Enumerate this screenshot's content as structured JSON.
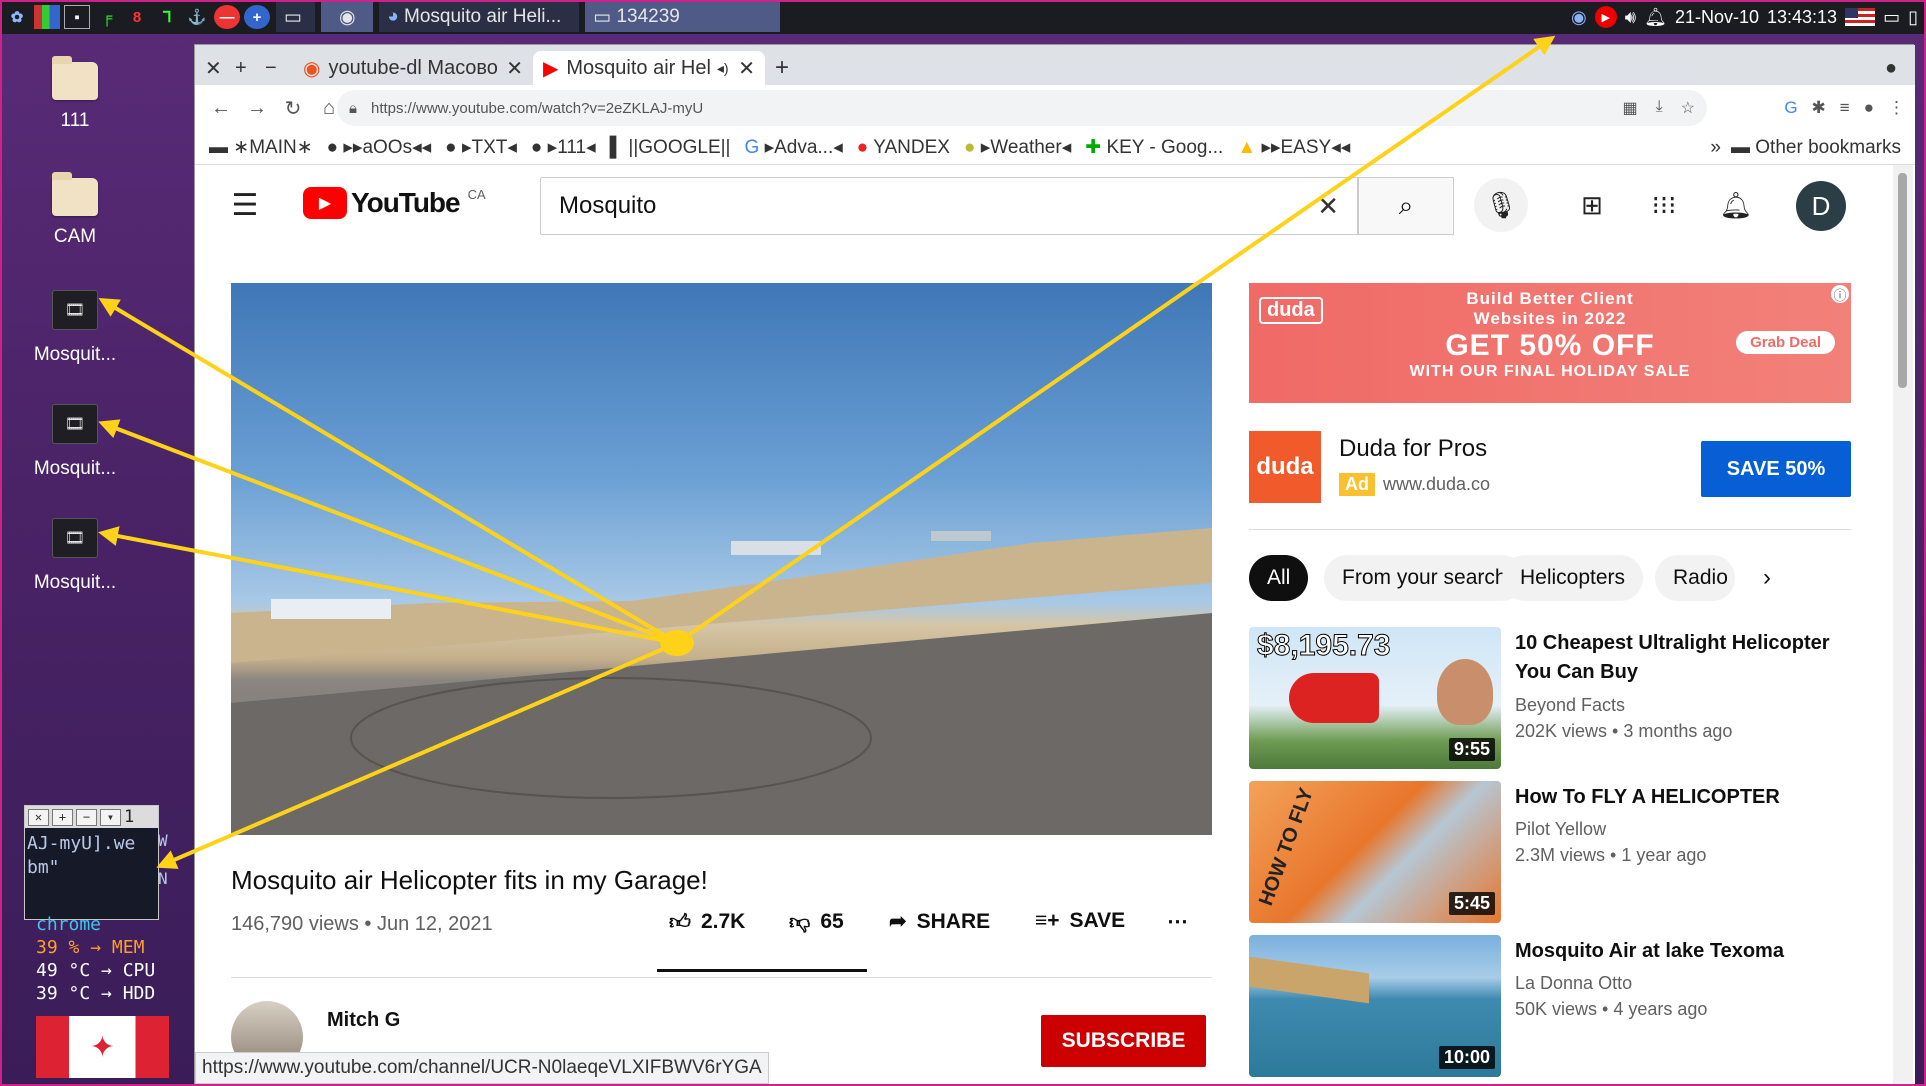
{
  "panel": {
    "tasks": [
      "",
      "Mosquito air Heli...",
      "134239"
    ],
    "date": "21-Nov-10",
    "time": "13:43:13"
  },
  "desktop": {
    "icons": [
      "111",
      "CAM",
      "Mosquit...",
      "Mosquit...",
      "Mosquit..."
    ]
  },
  "terminal": {
    "lines": [
      "AJ-myU].we",
      "bm\""
    ],
    "tab_number": "1",
    "right_chars": "W N",
    "process": "chrome"
  },
  "stats": [
    {
      "value": "39 %",
      "arrow": "→",
      "label": "MEM"
    },
    {
      "value": "49 °C",
      "arrow": "→",
      "label": "CPU"
    },
    {
      "value": "39 °C",
      "arrow": "→",
      "label": "HDD"
    }
  ],
  "browser": {
    "tabs": [
      "youtube-dl Macово",
      "Mosquito air Hel"
    ],
    "url": "https://www.youtube.com/watch?v=2eZKLAJ-myU",
    "bookmarks": [
      "∗MAIN∗",
      "▸▸aOOs◂◂",
      "▸TXT◂",
      "▸111◂",
      "||GOOGLE||",
      "▸Adva...◂",
      "YANDEX",
      "▸Weather◂",
      "KEY - Goog...",
      "▸▸EASY◂◂"
    ],
    "other_bookmarks": "Other bookmarks",
    "status_url": "https://www.youtube.com/channel/UCR-N0laeqeVLXIFBWV6rYGA"
  },
  "youtube": {
    "logo": "YouTube",
    "region": "CA",
    "search_value": "Mosquito",
    "avatar_letter": "D",
    "video_title": "Mosquito air Helicopter fits in my Garage!",
    "views_date": "146,790 views • Jun 12, 2021",
    "likes": "2.7K",
    "dislikes": "65",
    "share": "SHARE",
    "save": "SAVE",
    "channel": "Mitch G",
    "subscribe": "SUBSCRIBE",
    "ad": {
      "brand": "duda",
      "line1": "Build Better Client",
      "line2": "Websites in 2022",
      "headline": "GET 50% OFF",
      "cta_small": "Grab Deal",
      "line3": "WITH OUR FINAL HOLIDAY SALE",
      "title": "Duda for Pros",
      "ad_badge": "Ad",
      "domain": "www.duda.co",
      "button": "SAVE 50%"
    },
    "chips": [
      "All",
      "From your search",
      "Helicopters",
      "Radio"
    ],
    "recommendations": [
      {
        "title": "10 Cheapest Ultralight Helicopter You Can Buy",
        "channel": "Beyond Facts",
        "meta": "202K views • 3 months ago",
        "duration": "9:55",
        "overlay": "$8,195.73"
      },
      {
        "title": "How To FLY A HELICOPTER",
        "channel": "Pilot Yellow",
        "meta": "2.3M views • 1 year ago",
        "duration": "5:45",
        "overlay": "HOW TO FLY"
      },
      {
        "title": "Mosquito Air at lake Texoma",
        "channel": "La Donna Otto",
        "meta": "50K views • 4 years ago",
        "duration": "10:00",
        "overlay": ""
      }
    ]
  },
  "colors": {
    "accent_red": "#ff0000",
    "subscribe_red": "#cc0000",
    "arrow_yellow": "#ffd21a",
    "ad_blue": "#065fd4"
  }
}
